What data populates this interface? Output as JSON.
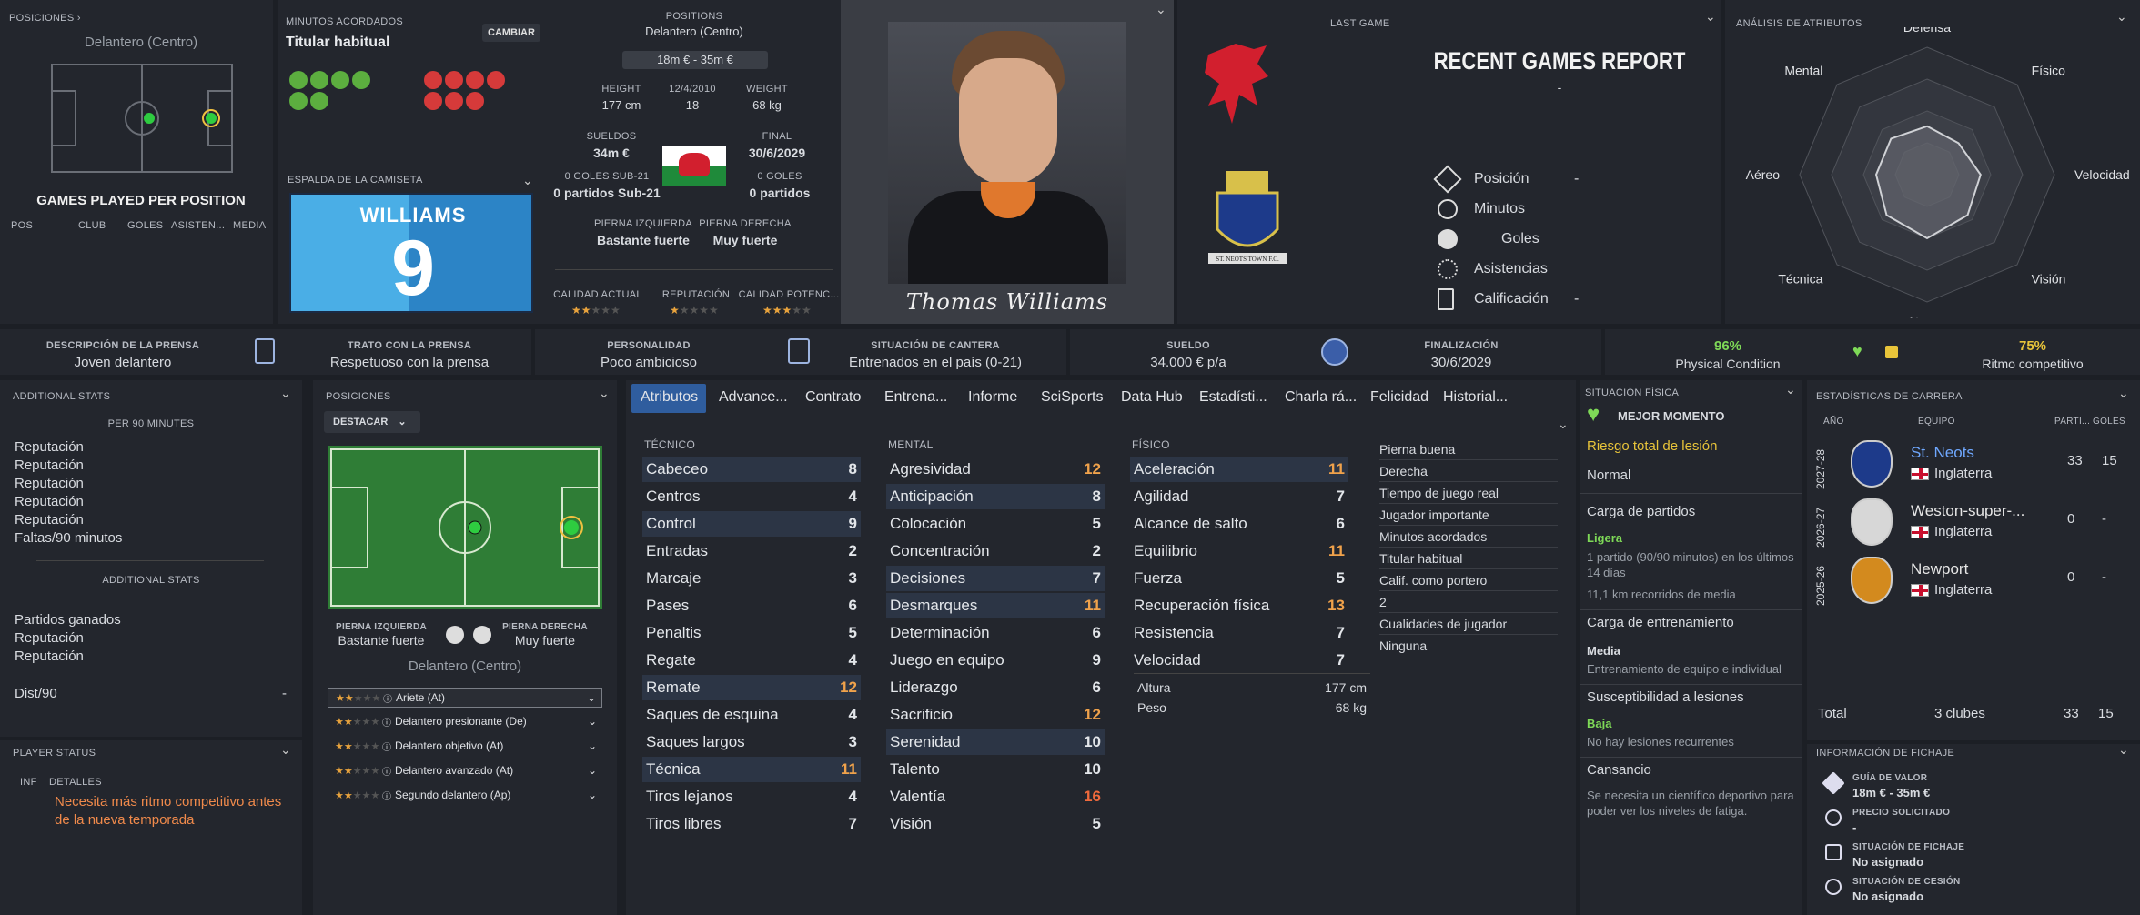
{
  "positions_panel": {
    "header": "POSICIONES",
    "position_name": "Delantero (Centro)",
    "games_title": "GAMES PLAYED PER POSITION",
    "cols": [
      "POS",
      "CLUB",
      "GOLES",
      "ASISTEN...",
      "MEDIA"
    ]
  },
  "agreed": {
    "label": "MINUTOS ACORDADOS",
    "value": "Titular habitual",
    "change_button": "CAMBIAR"
  },
  "shirt": {
    "label": "ESPALDA DE LA CAMISETA",
    "name": "WILLIAMS",
    "number": "9"
  },
  "info": {
    "positions_label": "POSITIONS",
    "positions_value": "Delantero (Centro)",
    "value_range": "18m € - 35m €",
    "height_label": "HEIGHT",
    "height": "177 cm",
    "dob": "12/4/2010",
    "age": "18",
    "weight_label": "WEIGHT",
    "weight": "68 kg",
    "wage_label": "SUELDOS",
    "wage": "34m €",
    "final_label": "FINAL",
    "final": "30/6/2029",
    "u21_goals": "0 GOLES SUB-21",
    "u21_games": "0 partidos Sub-21",
    "goals_label": "0 GOLES",
    "games": "0 partidos",
    "left_foot_label": "PIERNA IZQUIERDA",
    "left_foot": "Bastante fuerte",
    "right_foot_label": "PIERNA DERECHA",
    "right_foot": "Muy fuerte",
    "ca_label": "CALIDAD ACTUAL",
    "rep_label": "REPUTACIÓN",
    "pa_label": "CALIDAD POTENC..."
  },
  "player": {
    "signature": "Thomas Williams"
  },
  "last_game": {
    "label": "LAST GAME",
    "title": "RECENT GAMES REPORT",
    "subtitle": "-",
    "rows": [
      {
        "label": "Posición",
        "value": "-"
      },
      {
        "label": "Minutos",
        "value": ""
      },
      {
        "label": "Goles",
        "value": ""
      },
      {
        "label": "Asistencias",
        "value": ""
      },
      {
        "label": "Calificación",
        "value": "-"
      }
    ],
    "club_name": "ST. NEOTS TOWN F.C."
  },
  "radar": {
    "title": "ANÁLISIS DE ATRIBUTOS",
    "labels": [
      "Defensa",
      "Físico",
      "Velocidad",
      "Visión",
      "Ataque",
      "Técnica",
      "Aéreo",
      "Mental"
    ],
    "values": [
      0.38,
      0.35,
      0.42,
      0.45,
      0.5,
      0.45,
      0.4,
      0.4
    ]
  },
  "strip": {
    "press_desc_label": "DESCRIPCIÓN DE LA PRENSA",
    "press_desc": "Joven delantero",
    "press_label": "TRATO CON LA PRENSA",
    "press": "Respetuoso con la prensa",
    "pers_label": "PERSONALIDAD",
    "pers": "Poco ambicioso",
    "youth_label": "SITUACIÓN DE CANTERA",
    "youth": "Entrenados en el país (0-21)",
    "wage_label": "SUELDO",
    "wage": "34.000 € p/a",
    "end_label": "FINALIZACIÓN",
    "end": "30/6/2029",
    "cond_pct": "96%",
    "cond_label": "Physical Condition",
    "sharp_pct": "75%",
    "sharp_label": "Ritmo competitivo"
  },
  "additional": {
    "header": "ADDITIONAL STATS",
    "per90": "PER 90 MINUTES",
    "list1": [
      "Reputación",
      "Reputación",
      "Reputación",
      "Reputación",
      "Reputación",
      "Faltas/90 minutos"
    ],
    "sub": "ADDITIONAL STATS",
    "list2": [
      "Partidos ganados",
      "Reputación",
      "Reputación"
    ],
    "dist": "Dist/90",
    "dist_val": "-"
  },
  "status": {
    "header": "PLAYER STATUS",
    "col1": "INF",
    "col2": "DETALLES",
    "text": "Necesita más ritmo competitivo antes de la nueva temporada"
  },
  "pos2": {
    "header": "POSICIONES",
    "dropdown": "DESTACAR",
    "lf_label": "PIERNA IZQUIERDA",
    "lf": "Bastante fuerte",
    "rf_label": "PIERNA DERECHA",
    "rf": "Muy fuerte",
    "pos": "Delantero (Centro)",
    "roles": [
      "Ariete (At)",
      "Delantero presionante (De)",
      "Delantero objetivo (At)",
      "Delantero avanzado (At)",
      "Segundo delantero (Ap)"
    ]
  },
  "tabs": [
    "Atributos",
    "Advance...",
    "Contrato",
    "Entrena...",
    "Informe",
    "SciSports",
    "Data Hub",
    "Estadísti...",
    "Charla rá...",
    "Felicidad",
    "Historial..."
  ],
  "attrs": {
    "tech_title": "TÉCNICO",
    "mental_title": "MENTAL",
    "phys_title": "FÍSICO",
    "tech": [
      [
        "Cabeceo",
        "8"
      ],
      [
        "Centros",
        "4"
      ],
      [
        "Control",
        "9"
      ],
      [
        "Entradas",
        "2"
      ],
      [
        "Marcaje",
        "3"
      ],
      [
        "Pases",
        "6"
      ],
      [
        "Penaltis",
        "5"
      ],
      [
        "Regate",
        "4"
      ],
      [
        "Remate",
        "12"
      ],
      [
        "Saques de esquina",
        "4"
      ],
      [
        "Saques largos",
        "3"
      ],
      [
        "Técnica",
        "11"
      ],
      [
        "Tiros lejanos",
        "4"
      ],
      [
        "Tiros libres",
        "7"
      ]
    ],
    "mental": [
      [
        "Agresividad",
        "12"
      ],
      [
        "Anticipación",
        "8"
      ],
      [
        "Colocación",
        "5"
      ],
      [
        "Concentración",
        "2"
      ],
      [
        "Decisiones",
        "7"
      ],
      [
        "Desmarques",
        "11"
      ],
      [
        "Determinación",
        "6"
      ],
      [
        "Juego en equipo",
        "9"
      ],
      [
        "Liderazgo",
        "6"
      ],
      [
        "Sacrificio",
        "12"
      ],
      [
        "Serenidad",
        "10"
      ],
      [
        "Talento",
        "10"
      ],
      [
        "Valentía",
        "16"
      ],
      [
        "Visión",
        "5"
      ]
    ],
    "phys": [
      [
        "Aceleración",
        "11"
      ],
      [
        "Agilidad",
        "7"
      ],
      [
        "Alcance de salto",
        "6"
      ],
      [
        "Equilibrio",
        "11"
      ],
      [
        "Fuerza",
        "5"
      ],
      [
        "Recuperación física",
        "13"
      ],
      [
        "Resistencia",
        "7"
      ],
      [
        "Velocidad",
        "7"
      ]
    ],
    "height_label": "Altura",
    "height": "177 cm",
    "weight_label": "Peso",
    "weight": "68 kg"
  },
  "misc": [
    "Pierna buena",
    "Derecha",
    "Tiempo de juego real",
    "Jugador importante",
    "Minutos acordados",
    "Titular habitual",
    "Calif. como portero",
    "2",
    "Cualidades de jugador",
    "Ninguna"
  ],
  "physical": {
    "header": "SITUACIÓN FÍSICA",
    "best": "MEJOR MOMENTO",
    "risk": "Riesgo total de lesión",
    "normal": "Normal",
    "load_title": "Carga de partidos",
    "load_level": "Ligera",
    "load_desc": "1 partido (90/90 minutos) en los últimos 14 días",
    "load_km": "11,1 km recorridos de media",
    "train_title": "Carga de entrenamiento",
    "train_level": "Media",
    "train_desc": "Entrenamiento de equipo e individual",
    "inj_title": "Susceptibilidad a lesiones",
    "inj_level": "Baja",
    "inj_desc": "No hay lesiones recurrentes",
    "fat_title": "Cansancio",
    "fat_desc": "Se necesita un científico deportivo para poder ver los niveles de fatiga."
  },
  "career": {
    "header": "ESTADÍSTICAS DE CARRERA",
    "cols": [
      "AÑO",
      "EQUIPO",
      "PARTI...",
      "GOLES"
    ],
    "rows": [
      {
        "year": "2027-28",
        "club": "St. Neots",
        "country": "Inglaterra",
        "apps": "33",
        "goals": "15"
      },
      {
        "year": "2026-27",
        "club": "Weston-super-...",
        "country": "Inglaterra",
        "apps": "0",
        "goals": "-"
      },
      {
        "year": "2025-26",
        "club": "Newport",
        "country": "Inglaterra",
        "apps": "0",
        "goals": "-"
      }
    ],
    "total_label": "Total",
    "total_clubs": "3 clubes",
    "total_apps": "33",
    "total_goals": "15"
  },
  "transfer": {
    "header": "INFORMACIÓN DE FICHAJE",
    "items": [
      {
        "label": "GUÍA DE VALOR",
        "value": "18m € - 35m €"
      },
      {
        "label": "PRECIO SOLICITADO",
        "value": "-"
      },
      {
        "label": "SITUACIÓN DE FICHAJE",
        "value": "No asignado"
      },
      {
        "label": "SITUACIÓN DE CESIÓN",
        "value": "No asignado"
      }
    ]
  },
  "colors": {
    "bg": "#1c1f25",
    "panel": "#23262d",
    "accent_orange": "#f08a4b",
    "accent_green": "#7ed957",
    "tab_active": "#2f5d9e"
  }
}
